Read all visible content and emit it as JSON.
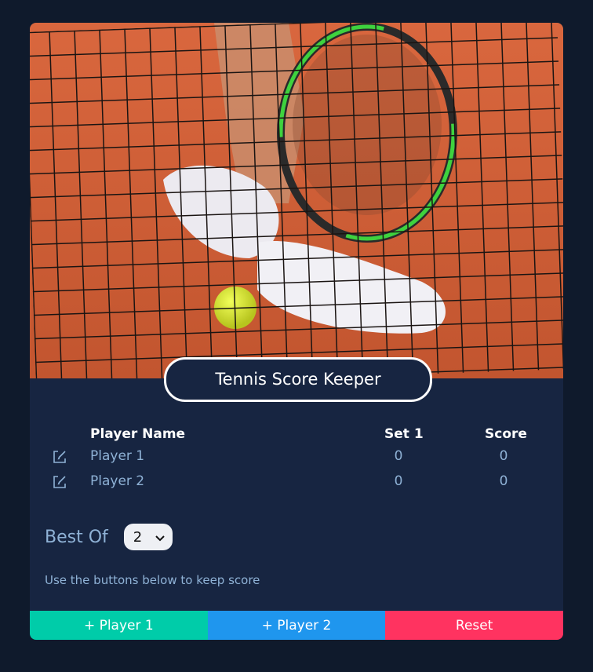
{
  "app": {
    "title": "Tennis Score Keeper"
  },
  "table": {
    "headers": {
      "name": "Player Name",
      "set": "Set 1",
      "score": "Score"
    },
    "rows": [
      {
        "name": "Player 1",
        "set1": "0",
        "score": "0",
        "edit_icon": "edit-icon"
      },
      {
        "name": "Player 2",
        "set1": "0",
        "score": "0",
        "edit_icon": "edit-icon"
      }
    ]
  },
  "best_of": {
    "label": "Best Of",
    "selected": "2"
  },
  "hint": "Use the buttons below to keep score",
  "buttons": {
    "player1": "+ Player 1",
    "player2": "+ Player 2",
    "reset": "Reset"
  },
  "colors": {
    "player1_button": "#00cca9",
    "player2_button": "#1f96ee",
    "reset_button": "#ff3360",
    "card_background": "#172541",
    "page_background": "#0f1a2c",
    "muted_text": "#8fb2d6"
  }
}
